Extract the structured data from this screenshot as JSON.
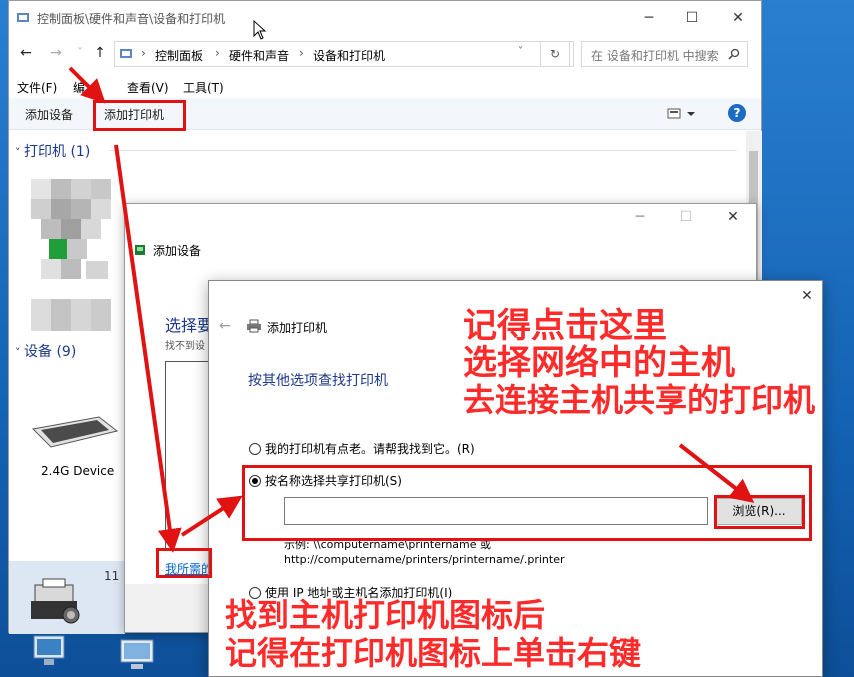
{
  "explorer": {
    "title": "控制面板\\硬件和声音\\设备和打印机",
    "breadcrumbs": [
      "控制面板",
      "硬件和声音",
      "设备和打印机"
    ],
    "search_placeholder": "在 设备和打印机 中搜索",
    "menu": [
      "文件(F)",
      "编",
      "查看(V)",
      "工具(T)"
    ],
    "toolbar": {
      "add_device": "添加设备",
      "add_printer": "添加打印机"
    },
    "printers_group": "打印机 (1)",
    "devices_group": "设备 (9)",
    "device_label": "2.4G Device",
    "count_badge": "11"
  },
  "add_device": {
    "title": "添加设备",
    "heading_partial": "选择要",
    "sub_partial": "找不到设",
    "link_partial": "我所需的"
  },
  "add_printer": {
    "title": "添加打印机",
    "heading": "按其他选项查找打印机",
    "option_old": "我的打印机有点老。请帮我找到它。(R)",
    "option_shared": "按名称选择共享打印机(S)",
    "browse_label": "浏览(R)...",
    "example_line1": "示例: \\\\computername\\printername 或",
    "example_line2": "http://computername/printers/printername/.printer",
    "option_ip": "使用 IP 地址或主机名添加打印机(I)"
  },
  "annotations": {
    "top_lines": [
      "记得点击这里",
      "选择网络中的主机",
      "去连接主机共享的打印机"
    ],
    "bottom_lines": [
      "找到主机打印机图标后",
      "记得在打印机图标上单击右键"
    ]
  },
  "colors": {
    "annotation": "#ff2a2a",
    "highlight": "#e01212",
    "link": "#0066cc",
    "heading": "#1e3a8a"
  }
}
